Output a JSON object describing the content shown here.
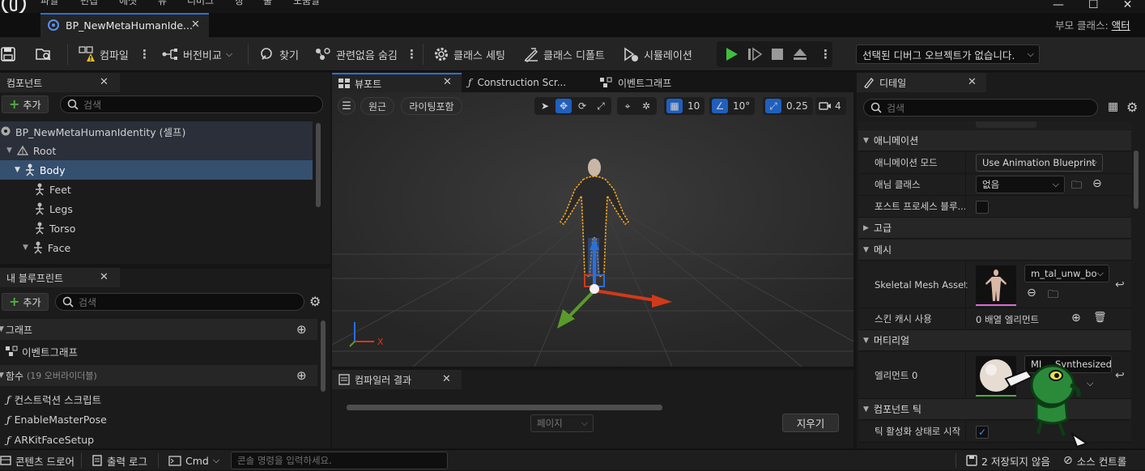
{
  "menu": {
    "items": [
      "파일",
      "편집",
      "에셋",
      "뷰",
      "디버그",
      "창",
      "툴",
      "도움말"
    ]
  },
  "doc_tab": {
    "title": "BP_NewMetaHumanIde..."
  },
  "parent_class": {
    "label": "부모 클래스:",
    "value": "액터"
  },
  "toolbar": {
    "compile": "컴파일",
    "diff": "버전비교",
    "find": "찾기",
    "hide_unrelated": "관련없음 숨김",
    "class_settings": "클래스 세팅",
    "class_defaults": "클래스 디폴트",
    "simulation": "시뮬레이션",
    "debug_object": "선택된 디버그 오브젝트가 없습니다."
  },
  "components": {
    "tab": "컴포넌트",
    "add": "추가",
    "search_placeholder": "검색",
    "tree": [
      {
        "label": "BP_NewMetaHumanIdentity (셀프)"
      },
      {
        "label": "Root"
      },
      {
        "label": "Body"
      },
      {
        "label": "Feet"
      },
      {
        "label": "Legs"
      },
      {
        "label": "Torso"
      },
      {
        "label": "Face"
      }
    ]
  },
  "my_blueprint": {
    "tab": "내 블루프린트",
    "add": "추가",
    "search_placeholder": "검색",
    "sections": {
      "graphs": "그래프",
      "functions": "함수",
      "functions_count": "(19 오버라이더블)"
    },
    "graph_items": [
      "이벤트그래프"
    ],
    "function_items": [
      "컨스트럭션 스크립트",
      "EnableMasterPose",
      "ARKitFaceSetup"
    ]
  },
  "center_tabs": {
    "viewport": "뷰포트",
    "construction": "Construction Scr...",
    "event_graph": "이벤트그래프"
  },
  "viewport": {
    "perspective": "원근",
    "lighting": "라이팅포함",
    "grid_snap": "10",
    "rot_snap": "10°",
    "scale_snap": "0.25",
    "camera_speed": "4",
    "axis_x": "X"
  },
  "compiler": {
    "tab": "컴파일러 결과",
    "page": "페이지",
    "clear": "지우기"
  },
  "details": {
    "tab": "디테일",
    "search_placeholder": "검색",
    "animation": {
      "section": "애니메이션",
      "mode_label": "애니메이션 모드",
      "mode_value": "Use Animation Blueprint",
      "class_label": "애님 클래스",
      "class_value": "없음",
      "post_label": "포스트 프로세스 블루..."
    },
    "advanced": "고급",
    "mesh": {
      "section": "메시",
      "asset_label": "Skeletal Mesh Asset",
      "asset_value": "m_tal_unw_bo",
      "skin_cache_label": "스킨 캐시 사용",
      "skin_cache_value": "0 배열 엘리먼트"
    },
    "material": {
      "section": "머티리얼",
      "element_label": "엘리먼트 0",
      "element_value": "MI_...Synthesized"
    },
    "component_tick": {
      "section": "컴포넌트 틱",
      "start_label": "틱 활성화 상태로 시작"
    }
  },
  "statusbar": {
    "content_drawer": "콘텐츠 드로어",
    "output_log": "출력 로그",
    "cmd": "Cmd",
    "console_placeholder": "콘솔 명령을 입력하세요.",
    "unsaved": "2 저장되지 않음",
    "source_control": "소스 컨트롤"
  },
  "colors": {
    "accent_blue": "#2f6fd3",
    "play_green": "#3fbf3f",
    "selection_orange": "#f5a623",
    "warning_yellow": "#f0c020"
  }
}
